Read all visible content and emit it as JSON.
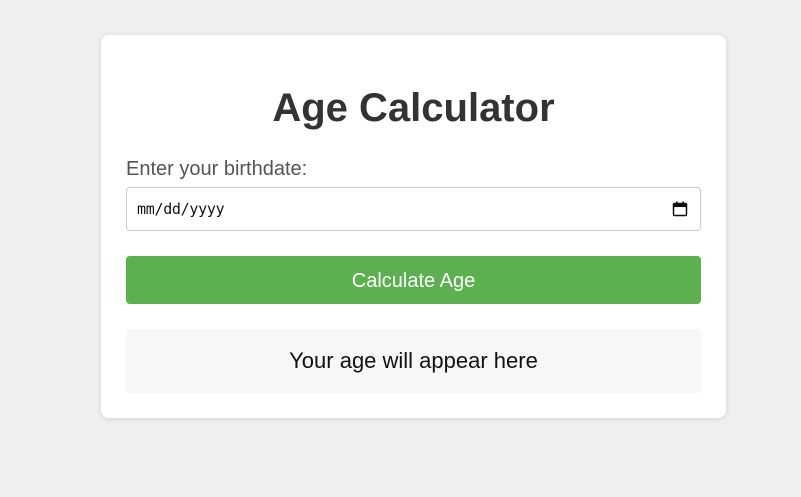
{
  "title": "Age Calculator",
  "birthdate": {
    "label": "Enter your birthdate:",
    "placeholder": "mm/dd/yyyy",
    "value": "",
    "icon": "calendar-icon"
  },
  "button": {
    "label": "Calculate Age",
    "color": "#5cb050"
  },
  "result": {
    "text": "Your age will appear here"
  }
}
